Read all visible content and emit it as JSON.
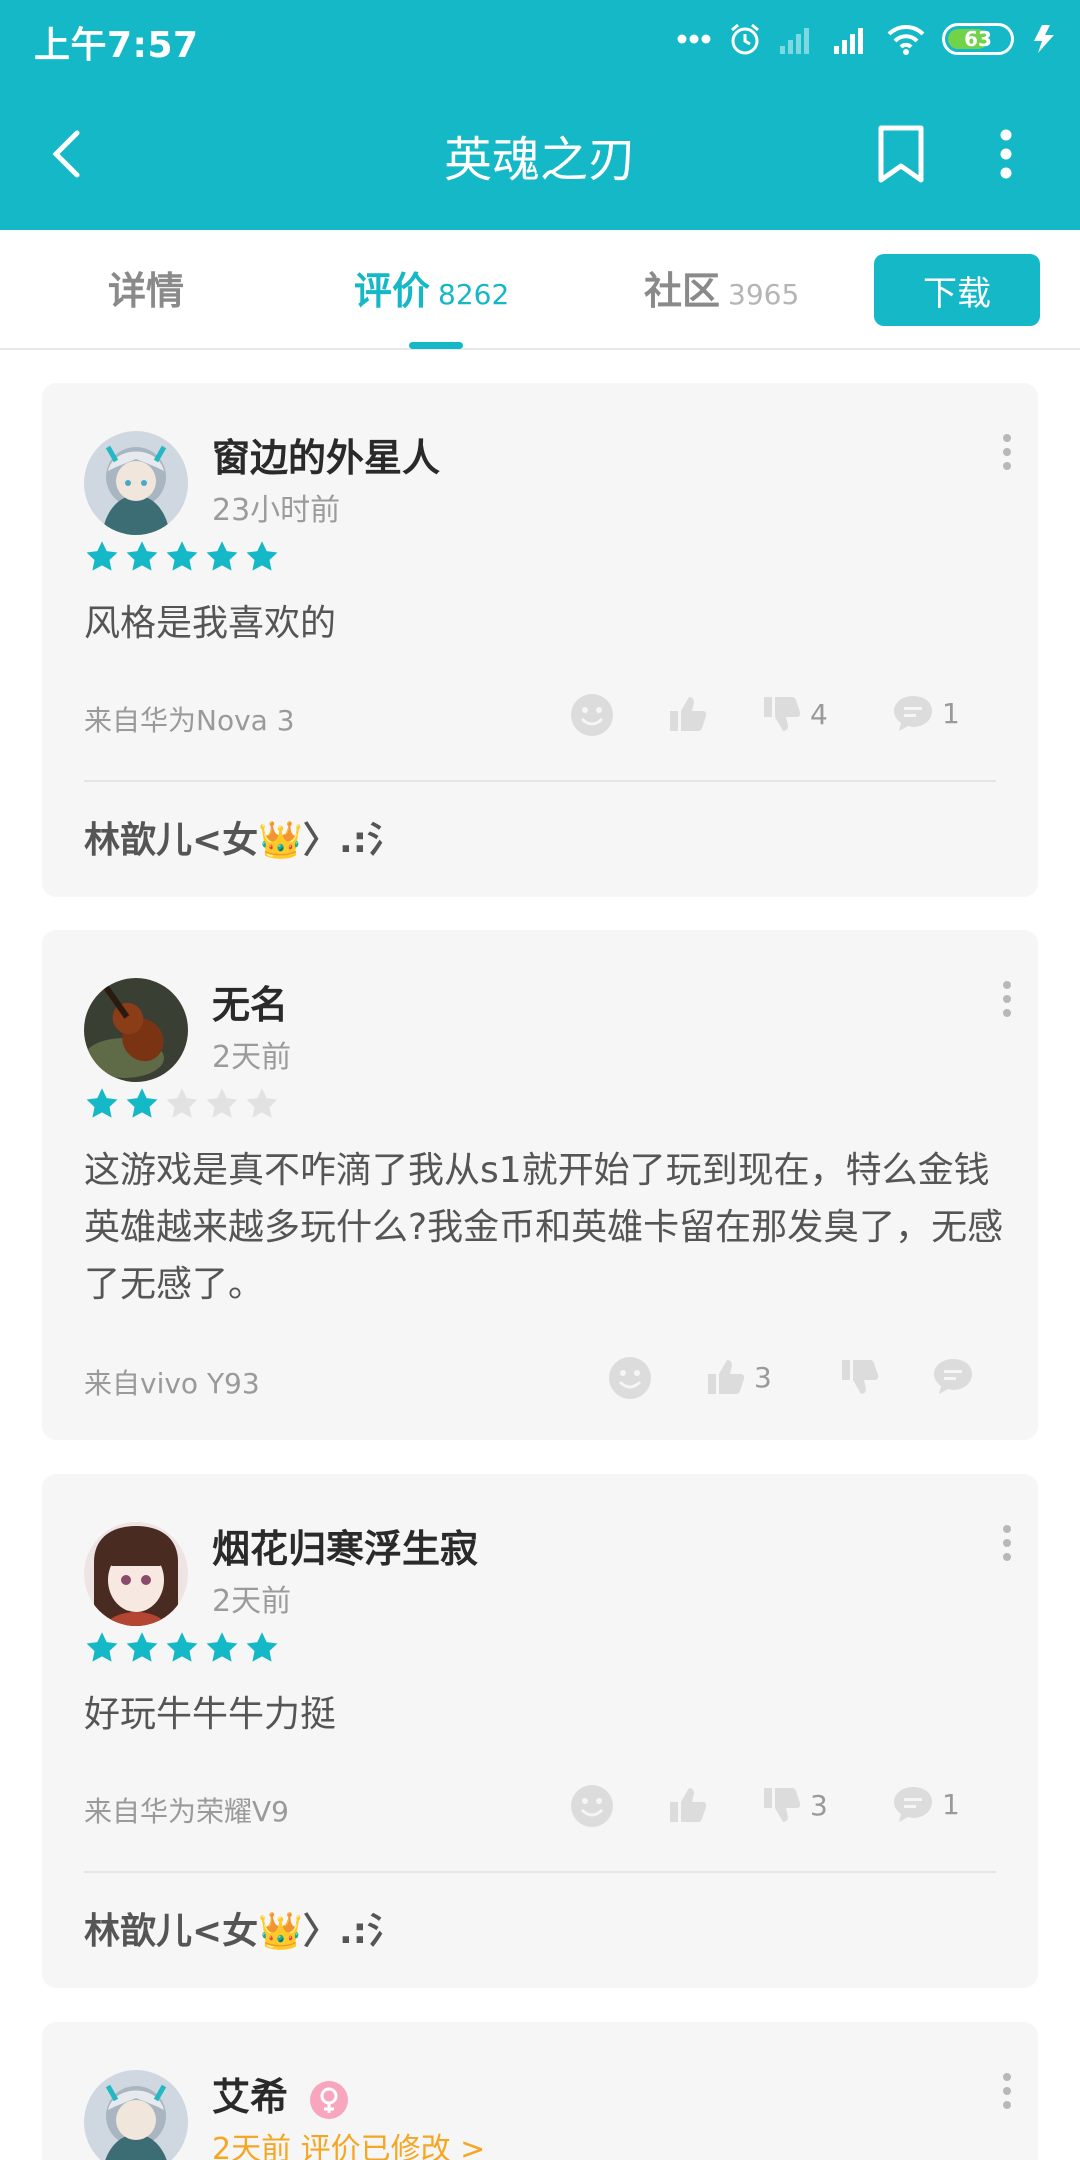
{
  "status_bar": {
    "time": "上午7:57",
    "battery": "63"
  },
  "app_bar": {
    "title": "英魂之刃"
  },
  "tabs": [
    {
      "label": "详情",
      "count": ""
    },
    {
      "label": "评价",
      "count": "8262"
    },
    {
      "label": "社区",
      "count": "3965"
    }
  ],
  "download_label": "下载",
  "colors": {
    "accent": "#15b8c6",
    "orange": "#f5a623"
  },
  "reviews": [
    {
      "username": "窗边的外星人",
      "time": "23小时前",
      "rating": 5,
      "text": "风格是我喜欢的",
      "device": "来自华为Nova 3",
      "dislike_count": "4",
      "comment_count": "1",
      "reply": "林歆儿<女👑〉.:氵"
    },
    {
      "username": "无名",
      "time": "2天前",
      "rating": 2,
      "text": "这游戏是真不咋滴了我从s1就开始了玩到现在，特么金钱英雄越来越多玩什么?我金币和英雄卡留在那发臭了，无感了无感了。",
      "device": "来自vivo Y93",
      "like_count": "3"
    },
    {
      "username": "烟花归寒浮生寂",
      "time": "2天前",
      "rating": 5,
      "text": "好玩牛牛牛力挺",
      "device": "来自华为荣耀V9",
      "dislike_count": "3",
      "comment_count": "1",
      "reply": "林歆儿<女👑〉.:氵"
    },
    {
      "username": "艾希",
      "time": "2天前 评价已修改 >"
    }
  ]
}
